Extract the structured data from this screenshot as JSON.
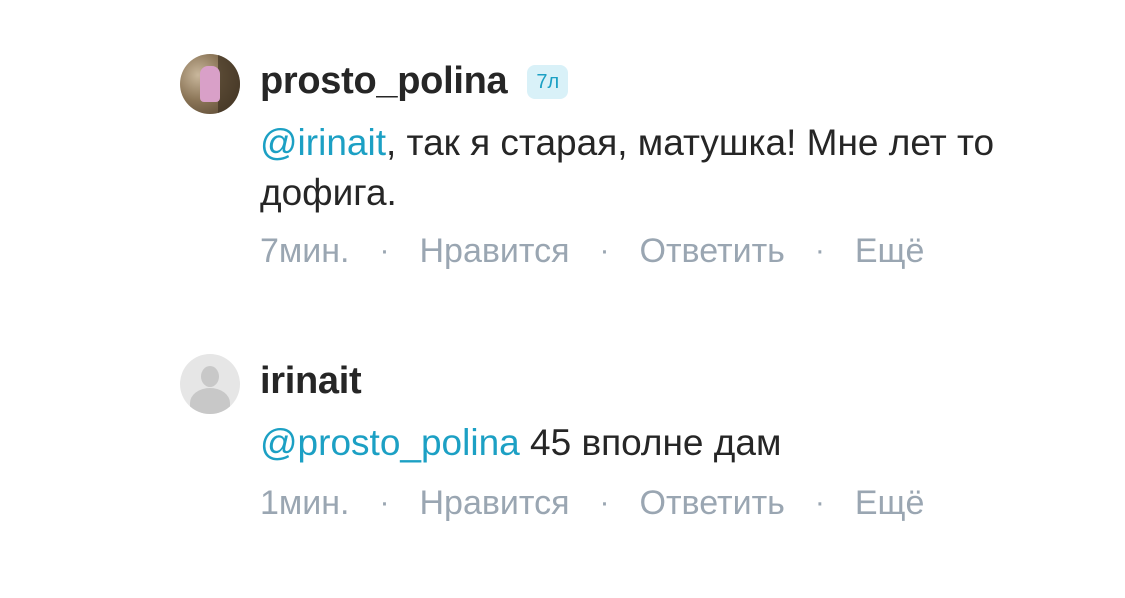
{
  "comments": [
    {
      "username": "prosto_polina",
      "badge": "7л",
      "mention": "@irinait",
      "text": ", так я старая, матушка! Мне лет то дофига.",
      "time": "7мин.",
      "like": "Нравится",
      "reply": "Ответить",
      "more": "Ещё"
    },
    {
      "username": "irinait",
      "mention": "@prosto_polina",
      "text": " 45 вполне дам",
      "time": "1мин.",
      "like": "Нравится",
      "reply": "Ответить",
      "more": "Ещё"
    }
  ],
  "separator": "·",
  "colors": {
    "mention": "#1ca0c4",
    "meta": "#9aa6b2",
    "text": "#262626",
    "badge_bg": "#d9f1f8"
  }
}
